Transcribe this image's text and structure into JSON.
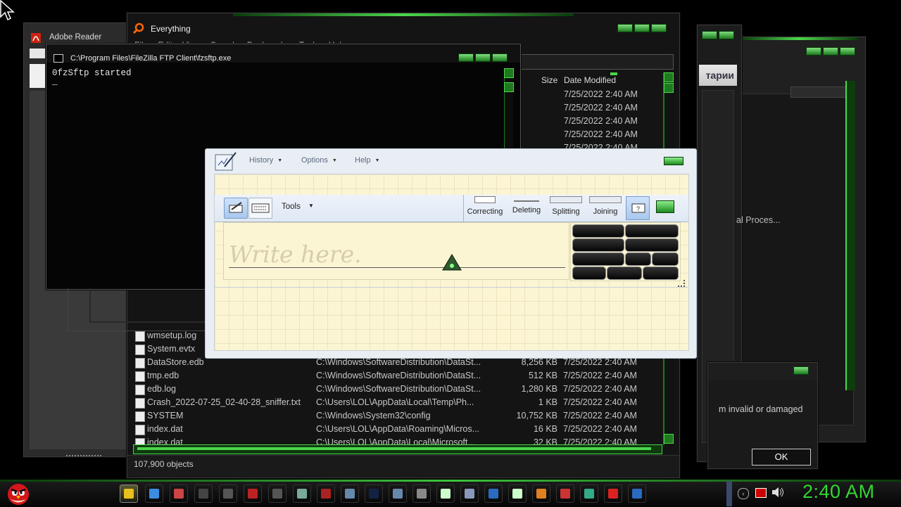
{
  "adobe": {
    "title": "Adobe Reader"
  },
  "everything": {
    "title": "Everything",
    "menu": [
      "File",
      "Edit",
      "View",
      "Search",
      "Bookmarks",
      "Tools",
      "Help"
    ],
    "columns": {
      "size": "Size",
      "date": "Date Modified"
    },
    "top_dates": [
      "7/25/2022 2:40 AM",
      "7/25/2022 2:40 AM",
      "7/25/2022 2:40 AM",
      "7/25/2022 2:40 AM",
      "7/25/2022 2:40 AM"
    ],
    "rows": [
      {
        "name": "wmsetup.log",
        "path": "",
        "size": "",
        "date": ""
      },
      {
        "name": "System.evtx",
        "path": "",
        "size": "",
        "date": ""
      },
      {
        "name": "DataStore.edb",
        "path": "C:\\Windows\\SoftwareDistribution\\DataSt...",
        "size": "8,256 KB",
        "date": "7/25/2022 2:40 AM"
      },
      {
        "name": "tmp.edb",
        "path": "C:\\Windows\\SoftwareDistribution\\DataSt...",
        "size": "512 KB",
        "date": "7/25/2022 2:40 AM"
      },
      {
        "name": "edb.log",
        "path": "C:\\Windows\\SoftwareDistribution\\DataSt...",
        "size": "1,280 KB",
        "date": "7/25/2022 2:40 AM"
      },
      {
        "name": "Crash_2022-07-25_02-40-28_sniffer.txt",
        "path": "C:\\Users\\LOL\\AppData\\Local\\Temp\\Ph...",
        "size": "1 KB",
        "date": "7/25/2022 2:40 AM"
      },
      {
        "name": "SYSTEM",
        "path": "C:\\Windows\\System32\\config",
        "size": "10,752 KB",
        "date": "7/25/2022 2:40 AM"
      },
      {
        "name": "index.dat",
        "path": "C:\\Users\\LOL\\AppData\\Roaming\\Micros...",
        "size": "16 KB",
        "date": "7/25/2022 2:40 AM"
      },
      {
        "name": "index.dat",
        "path": "C:\\Users\\LOL\\AppData\\Local\\Microsoft...",
        "size": "32 KB",
        "date": "7/25/2022 2:40 AM"
      }
    ],
    "status": "107,900 objects"
  },
  "console": {
    "title": "C:\\Program Files\\FileZilla FTP Client\\fzsftp.exe",
    "output": "0fzSftp started",
    "cursor": "_"
  },
  "right_window": {
    "button": "тарии",
    "text": "al Proces..."
  },
  "dialog": {
    "text": "m invalid or damaged",
    "ok": "OK"
  },
  "input_panel": {
    "menus": {
      "history": "History",
      "options": "Options",
      "help": "Help"
    },
    "tools": "Tools",
    "gestures": {
      "correcting": "Correcting",
      "deleting": "Deleting",
      "splitting": "Splitting",
      "joining": "Joining"
    },
    "placeholder": "Write here."
  },
  "taskbar": {
    "clock": "2:40 AM"
  },
  "colors": {
    "accent": "#4cd64c",
    "panel": "#e9eef4",
    "paper": "#fbf5d4"
  }
}
